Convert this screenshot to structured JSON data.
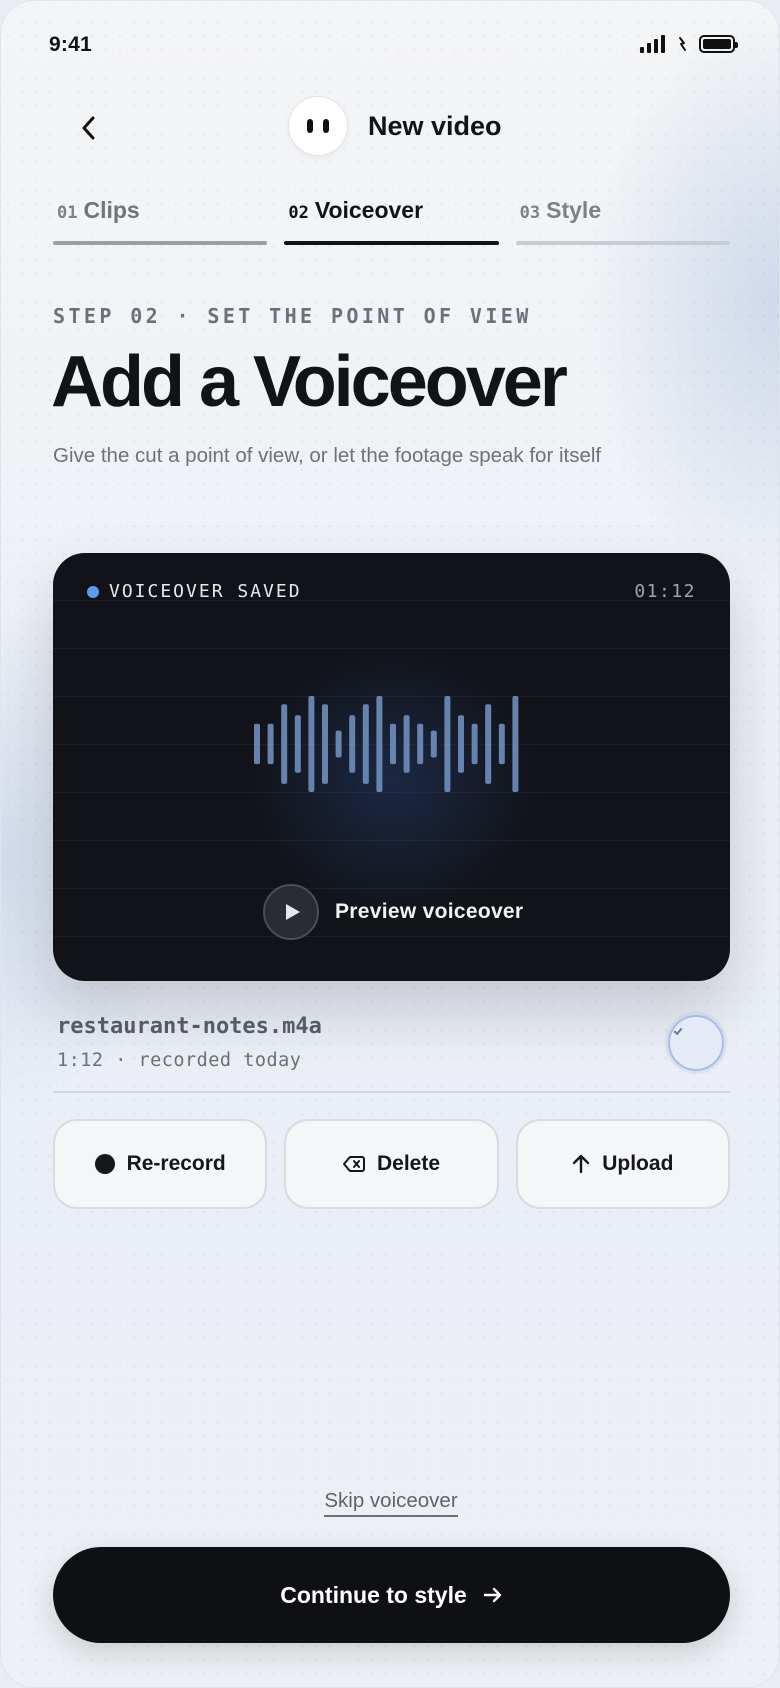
{
  "status_bar": {
    "time": "9:41"
  },
  "header": {
    "title": "New video"
  },
  "tabs": [
    {
      "num": "01",
      "label": "Clips",
      "state": "done"
    },
    {
      "num": "02",
      "label": "Voiceover",
      "state": "active"
    },
    {
      "num": "03",
      "label": "Style",
      "state": "upcoming"
    }
  ],
  "step_label": "STEP 02 · SET THE POINT OF VIEW",
  "page_title": "Add a Voiceover",
  "subtitle": "Give the cut a point of view, or let the footage speak for itself",
  "card": {
    "status": "VOICEOVER SAVED",
    "duration": "01:12",
    "preview_label": "Preview voiceover",
    "accent": "#5b9cf2",
    "waveform_levels": [
      0.42,
      0.42,
      0.83,
      0.6,
      1.0,
      0.83,
      0.28,
      0.6,
      0.83,
      1.0,
      0.42,
      0.6,
      0.42,
      0.28,
      1.0,
      0.6,
      0.42,
      0.83,
      0.42,
      1.0
    ]
  },
  "file": {
    "name": "restaurant-notes.m4a",
    "meta": "1:12 · recorded today"
  },
  "actions": {
    "rerecord": "Re-record",
    "delete": "Delete",
    "upload": "Upload"
  },
  "skip_label": "Skip voiceover",
  "cta_label": "Continue to style"
}
